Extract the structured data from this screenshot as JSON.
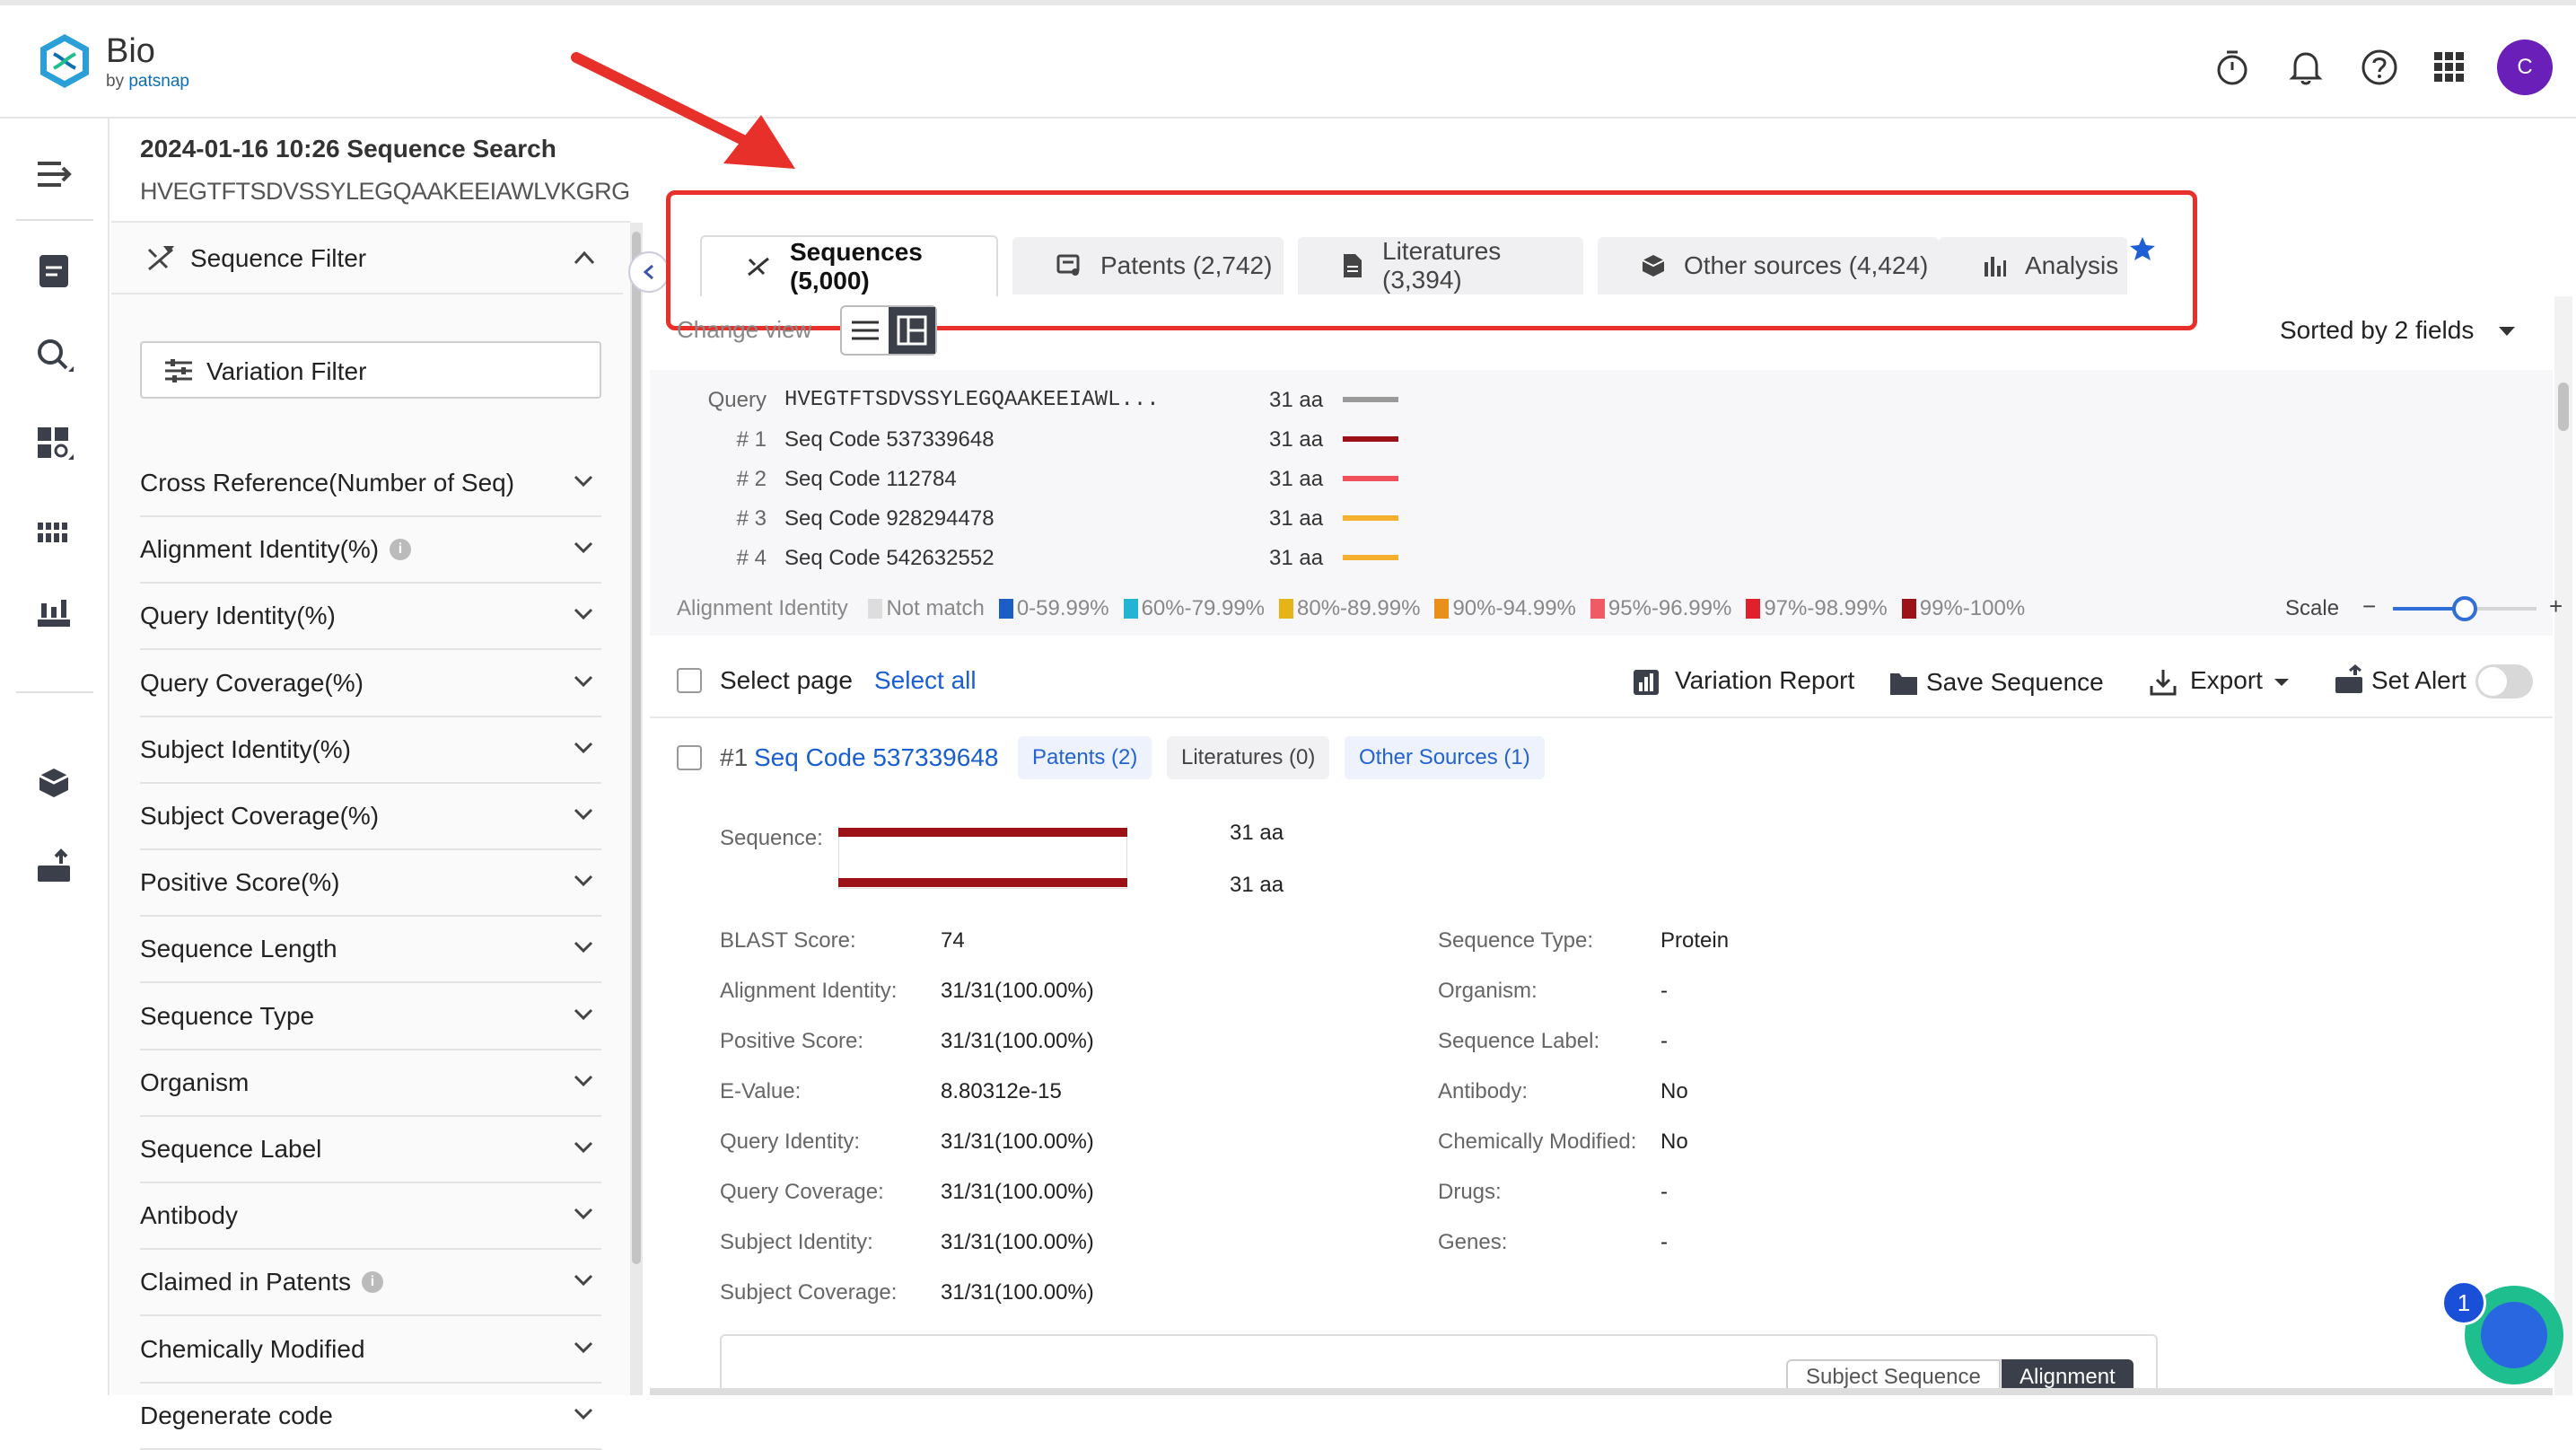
{
  "brand": {
    "name": "Bio",
    "by": "by ",
    "company": "patsnap"
  },
  "user": {
    "initial": "C"
  },
  "search": {
    "title": "2024-01-16 10:26 Sequence Search",
    "query_sequence": "HVEGTFTSDVSSYLEGQAAKEEIAWLVKGRG"
  },
  "filter": {
    "title": "Sequence Filter",
    "variation_button": "Variation Filter",
    "items": [
      {
        "label": "Cross Reference(Number of Seq)",
        "info": false
      },
      {
        "label": "Alignment Identity(%)",
        "info": true
      },
      {
        "label": "Query Identity(%)",
        "info": false
      },
      {
        "label": "Query Coverage(%)",
        "info": false
      },
      {
        "label": "Subject Identity(%)",
        "info": false
      },
      {
        "label": "Subject Coverage(%)",
        "info": false
      },
      {
        "label": "Positive Score(%)",
        "info": false
      },
      {
        "label": "Sequence Length",
        "info": false
      },
      {
        "label": "Sequence Type",
        "info": false
      },
      {
        "label": "Organism",
        "info": false
      },
      {
        "label": "Sequence Label",
        "info": false
      },
      {
        "label": "Antibody",
        "info": false
      },
      {
        "label": "Claimed in Patents",
        "info": true
      },
      {
        "label": "Chemically Modified",
        "info": false
      },
      {
        "label": "Degenerate code",
        "info": false
      }
    ]
  },
  "tabs": [
    {
      "label": "Sequences (5,000)",
      "active": true
    },
    {
      "label": "Patents (2,742)",
      "active": false
    },
    {
      "label": "Literatures (3,394)",
      "active": false
    },
    {
      "label": "Other sources (4,424)",
      "active": false
    },
    {
      "label": "Analysis",
      "active": false
    }
  ],
  "view": {
    "change_view": "Change view",
    "sorted": "Sorted by 2 fields"
  },
  "summary": {
    "query_label": "Query",
    "query_seq": "HVEGTFTSDVSSYLEGQAAKEEIAWL...",
    "query_len": "31 aa",
    "query_color": "#9a9a9a",
    "rows": [
      {
        "num": "# 1",
        "name": "Seq Code 537339648",
        "len": "31 aa",
        "color": "#9c1117"
      },
      {
        "num": "# 2",
        "name": "Seq Code 112784",
        "len": "31 aa",
        "color": "#f0505a"
      },
      {
        "num": "# 3",
        "name": "Seq Code 928294478",
        "len": "31 aa",
        "color": "#f5b030"
      },
      {
        "num": "# 4",
        "name": "Seq Code 542632552",
        "len": "31 aa",
        "color": "#f5b030"
      }
    ],
    "legend_title": "Alignment Identity",
    "legend": [
      {
        "label": "Not match",
        "color": "#dddddd"
      },
      {
        "label": "0-59.99%",
        "color": "#1c5fc4"
      },
      {
        "label": "60%-79.99%",
        "color": "#22b4d2"
      },
      {
        "label": "80%-89.99%",
        "color": "#e6b418"
      },
      {
        "label": "90%-94.99%",
        "color": "#e8901a"
      },
      {
        "label": "95%-96.99%",
        "color": "#f05a64"
      },
      {
        "label": "97%-98.99%",
        "color": "#e0202a"
      },
      {
        "label": "99%-100%",
        "color": "#9c1117"
      }
    ],
    "scale_label": "Scale",
    "scale_minus": "−",
    "scale_plus": "+"
  },
  "actions": {
    "select_page": "Select page",
    "select_all": "Select all",
    "variation_report": "Variation Report",
    "save_sequence": "Save Sequence",
    "export": "Export",
    "set_alert": "Set Alert"
  },
  "result": {
    "num": "#1",
    "title": "Seq Code 537339648",
    "patents": "Patents (2)",
    "literatures": "Literatures (0)",
    "other_sources": "Other Sources (1)",
    "sequence_label": "Sequence:",
    "len1": "31 aa",
    "len2": "31 aa",
    "left_fields": [
      {
        "k": "BLAST Score:",
        "v": "74"
      },
      {
        "k": "Alignment Identity:",
        "v": "31/31(100.00%)"
      },
      {
        "k": "Positive Score:",
        "v": "31/31(100.00%)"
      },
      {
        "k": "E-Value:",
        "v": "8.80312e-15"
      },
      {
        "k": "Query Identity:",
        "v": "31/31(100.00%)"
      },
      {
        "k": "Query Coverage:",
        "v": "31/31(100.00%)"
      },
      {
        "k": "Subject Identity:",
        "v": "31/31(100.00%)"
      },
      {
        "k": "Subject Coverage:",
        "v": "31/31(100.00%)"
      }
    ],
    "right_fields": [
      {
        "k": "Sequence Type:",
        "v": "Protein"
      },
      {
        "k": "Organism:",
        "v": "-"
      },
      {
        "k": "Sequence Label:",
        "v": "-"
      },
      {
        "k": "Antibody:",
        "v": "No"
      },
      {
        "k": "Chemically Modified:",
        "v": "No"
      },
      {
        "k": "Drugs:",
        "v": "-"
      },
      {
        "k": "Genes:",
        "v": "-"
      }
    ],
    "segment_left": "Subject Sequence",
    "segment_right": "Alignment"
  },
  "fab_badge": "1",
  "icons": [
    "logo-icon",
    "timer-icon",
    "bell-icon",
    "help-icon",
    "apps-grid-icon",
    "menu-expand-icon",
    "document-icon",
    "search-icon",
    "dashboard-icon",
    "sequence-icon",
    "chart-icon",
    "box-icon",
    "upload-icon",
    "star-icon",
    "arrow-annotation",
    "list-view-icon",
    "card-view-icon"
  ]
}
